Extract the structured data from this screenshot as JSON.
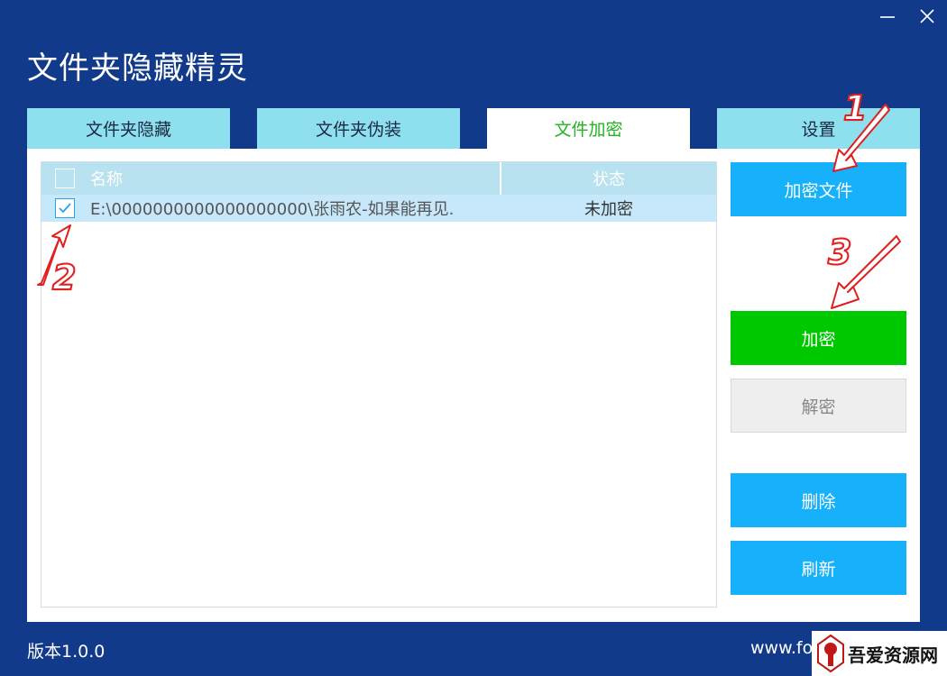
{
  "window": {
    "title": "文件夹隐藏精灵",
    "minimize_icon": "minimize-icon",
    "close_icon": "close-icon"
  },
  "tabs": [
    {
      "label": "文件夹隐藏",
      "active": false
    },
    {
      "label": "文件夹伪装",
      "active": false
    },
    {
      "label": "文件加密",
      "active": true
    },
    {
      "label": "设置",
      "active": false
    }
  ],
  "file_list": {
    "columns": {
      "name": "名称",
      "status": "状态"
    },
    "rows": [
      {
        "checked": true,
        "name": "E:\\0000000000000000000\\张雨农-如果能再见.",
        "status": "未加密"
      }
    ]
  },
  "buttons": {
    "add_file": "加密文件",
    "encrypt": "加密",
    "decrypt": "解密",
    "delete": "删除",
    "refresh": "刷新"
  },
  "footer": {
    "version": "版本1.0.0",
    "website": "www.fo"
  },
  "watermark": {
    "text": "吾爱资源网"
  },
  "annotations": [
    "1",
    "2",
    "3"
  ],
  "colors": {
    "background": "#123a8a",
    "tab": "#8fe0ee",
    "tab_active_text": "#22b422",
    "button_blue": "#16b1fa",
    "button_green": "#00c800",
    "annotation_red": "#e02020"
  }
}
